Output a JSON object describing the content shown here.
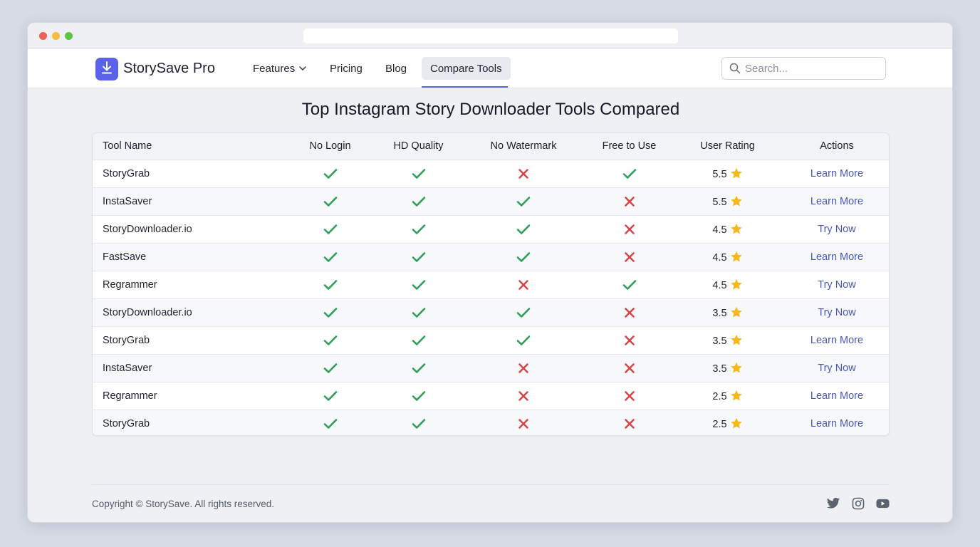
{
  "brand": {
    "name": "StorySave Pro",
    "logo_icon": "download-icon",
    "accent": "#5b62ea"
  },
  "nav": {
    "items": [
      {
        "label": "Features",
        "has_dropdown": true
      },
      {
        "label": "Pricing"
      },
      {
        "label": "Blog"
      },
      {
        "label": "Compare Tools",
        "active": true
      }
    ]
  },
  "search": {
    "placeholder": "Search...",
    "value": ""
  },
  "page": {
    "title": "Top Instagram Story Downloader Tools Compared"
  },
  "table": {
    "headers": [
      "Tool Name",
      "No Login",
      "HD Quality",
      "No Watermark",
      "Free to Use",
      "User Rating",
      "Actions"
    ],
    "rows": [
      {
        "name": "StoryGrab",
        "no_login": true,
        "hd": true,
        "no_watermark": false,
        "free": true,
        "rating": "5.5",
        "action": "Learn More"
      },
      {
        "name": "InstaSaver",
        "no_login": true,
        "hd": true,
        "no_watermark": true,
        "free": false,
        "rating": "5.5",
        "action": "Learn More"
      },
      {
        "name": "StoryDownloader.io",
        "no_login": true,
        "hd": true,
        "no_watermark": true,
        "free": false,
        "rating": "4.5",
        "action": "Try Now"
      },
      {
        "name": "FastSave",
        "no_login": true,
        "hd": true,
        "no_watermark": true,
        "free": false,
        "rating": "4.5",
        "action": "Learn More"
      },
      {
        "name": "Regrammer",
        "no_login": true,
        "hd": true,
        "no_watermark": false,
        "free": true,
        "rating": "4.5",
        "action": "Try Now"
      },
      {
        "name": "StoryDownloader.io",
        "no_login": true,
        "hd": true,
        "no_watermark": true,
        "free": false,
        "rating": "3.5",
        "action": "Try Now"
      },
      {
        "name": "StoryGrab",
        "no_login": true,
        "hd": true,
        "no_watermark": true,
        "free": false,
        "rating": "3.5",
        "action": "Learn More"
      },
      {
        "name": "InstaSaver",
        "no_login": true,
        "hd": true,
        "no_watermark": false,
        "free": false,
        "rating": "3.5",
        "action": "Try Now"
      },
      {
        "name": "Regrammer",
        "no_login": true,
        "hd": true,
        "no_watermark": false,
        "free": false,
        "rating": "2.5",
        "action": "Learn More"
      },
      {
        "name": "StoryGrab",
        "no_login": true,
        "hd": true,
        "no_watermark": false,
        "free": false,
        "rating": "2.5",
        "action": "Learn More"
      }
    ]
  },
  "colors": {
    "check": "#2e9e5b",
    "cross": "#d64545",
    "star": "#f5b81e",
    "link": "#4a58b8"
  },
  "footer": {
    "copyright": "Copyright © StorySave. All rights reserved.",
    "social_icons": [
      "twitter-icon",
      "instagram-icon",
      "youtube-icon"
    ]
  }
}
